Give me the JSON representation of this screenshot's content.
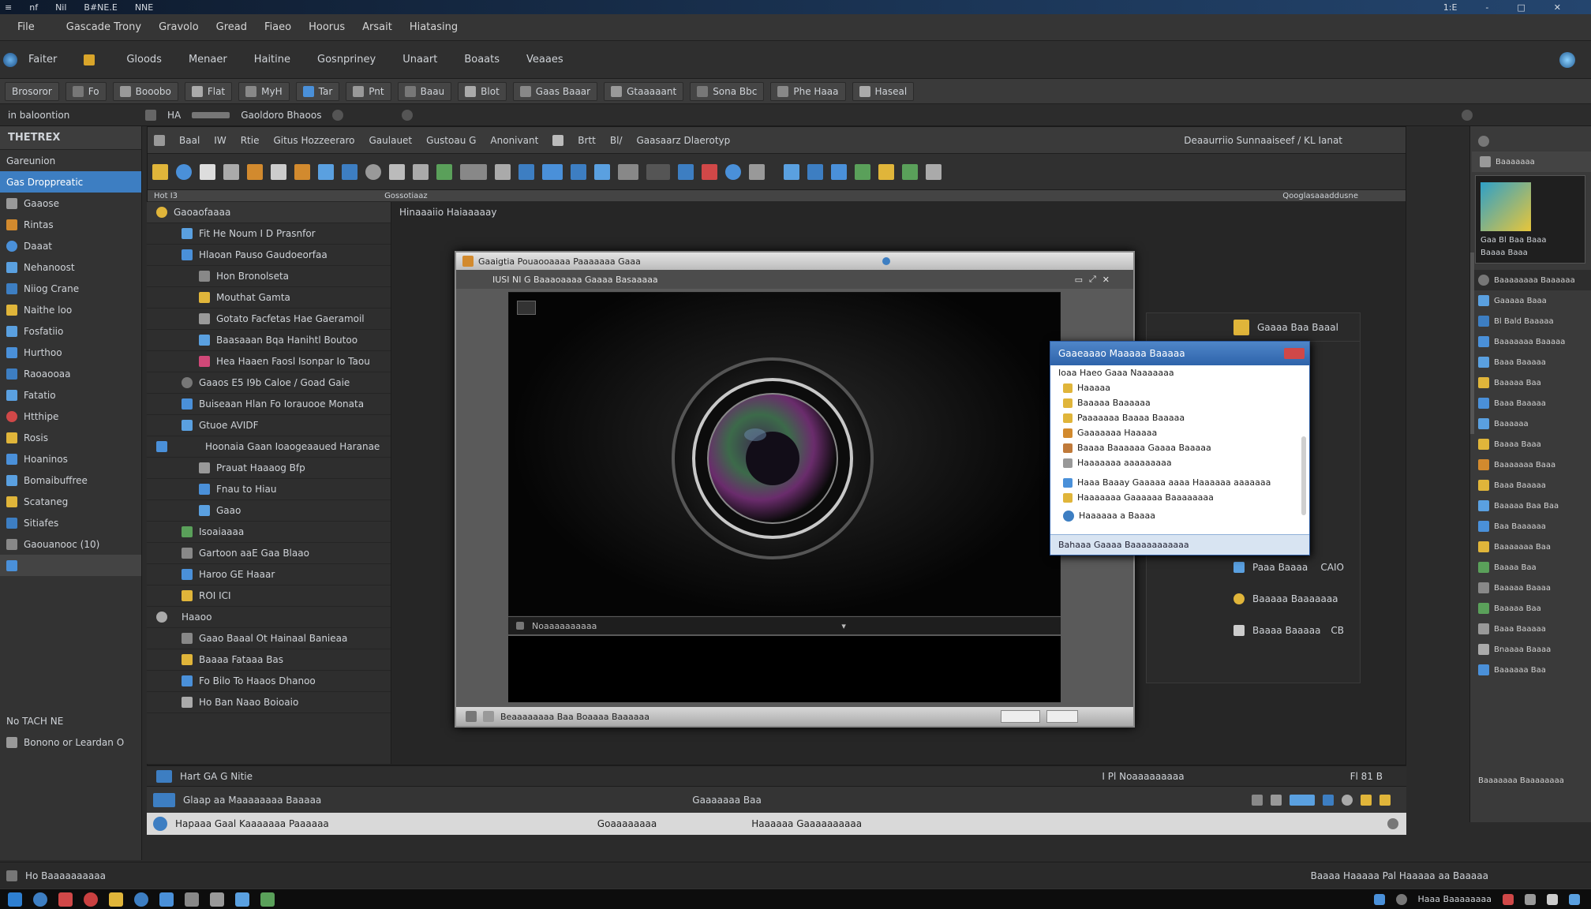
{
  "titlebar": {
    "items": [
      "≡",
      "nf",
      "Nil",
      "B#NE.E",
      "NNE"
    ],
    "right": [
      "1:E",
      "-",
      "□",
      "✕"
    ]
  },
  "menubar": {
    "items": [
      "File",
      "Gascade Trony",
      "Gravolo",
      "Gread",
      "Fiaeo",
      "Hoorus",
      "Arsait",
      "Hiatasing"
    ]
  },
  "menubar2": {
    "left": "Faiter",
    "items": [
      "Gloods",
      "Menaer",
      "Haitine",
      "Gosnpriney",
      "Unaart",
      "Boaats",
      "Veaaes"
    ]
  },
  "toolbar": {
    "items": [
      "Brosoror",
      "Fo",
      "Booobo",
      "Flat",
      "MyH",
      "Tar",
      "Pnt",
      "Baau",
      "Blot",
      "Gaas Baaar",
      "Gtaaaaant",
      "Sona Bbc",
      "Phe Haaa",
      "Haseal"
    ]
  },
  "subbar": {
    "left": "in baloontion",
    "mid": [
      "HA",
      "Gaoldoro Bhaoos"
    ]
  },
  "leftpanel": {
    "header": "THETREX",
    "items": [
      "Gareunion",
      "Gas Droppreatic",
      "Gaaose",
      "Rintas",
      "Daaat",
      "Nehanoost",
      "Niiog Crane",
      "Naithe loo",
      "Fosfatiio",
      "Hurthoo",
      "Raoaooaa",
      "Fatatio",
      "Htthipe",
      "Rosis",
      "Hoaninos",
      "Bomaibuffree",
      "Scataneg",
      "Sitiafes",
      "Gaouanooc (10)"
    ],
    "bottom": [
      "No TACH NE",
      "Bonono or Leardan O"
    ]
  },
  "ribbon": {
    "items": [
      "Baal",
      "IW",
      "Rtie",
      "Gitus Hozzeeraro",
      "Gaulauet",
      "Gustoau G",
      "Anonivant",
      "Brtt",
      "Bl/",
      "Gaasaarz Dlaerotyp"
    ],
    "right": "Deaaurriio Sunnaaiseef / KL Ianat"
  },
  "tabrow": {
    "left": "Hot I3",
    "mid": "Gossotiaaz",
    "right": "Qooglasaaaddusne"
  },
  "tree": {
    "header": "Gaoaofaaaa",
    "nodes": [
      {
        "lv": 1,
        "label": "Fit He Noum I D Prasnfor"
      },
      {
        "lv": 1,
        "label": "Hlaoan Pauso Gaudoeorfaa"
      },
      {
        "lv": 2,
        "label": "Hon Bronolseta"
      },
      {
        "lv": 2,
        "label": "Mouthat Gamta"
      },
      {
        "lv": 2,
        "label": "Gotato Facfetas Hae Gaeramoil"
      },
      {
        "lv": 2,
        "label": "Baasaaan Bqa Hanihtl Boutoo"
      },
      {
        "lv": 2,
        "label": "Hea Haaen Faosl Isonpar Io Taou"
      },
      {
        "lv": 1,
        "label": "Gaaos E5 I9b Caloe / Goad Gaie"
      },
      {
        "lv": 1,
        "label": "Buiseaan Hlan Fo Iorauooe Monata"
      },
      {
        "lv": 1,
        "label": "Gtuoe AVIDF"
      },
      {
        "lv": 1,
        "label": "Hoonaia Gaan Ioaogeaaued Haranae"
      },
      {
        "lv": 2,
        "label": "Prauat Haaaog Bfp"
      },
      {
        "lv": 2,
        "label": "Fnau to Hiau"
      },
      {
        "lv": 2,
        "label": "Gaao"
      },
      {
        "lv": 1,
        "label": "Isoaiaaaa"
      },
      {
        "lv": 1,
        "label": "Gartoon aaE Gaa Blaao"
      },
      {
        "lv": 1,
        "label": "Haroo GE Haaar"
      },
      {
        "lv": 1,
        "label": "ROI ICI"
      },
      {
        "lv": 1,
        "label": "Haaoo"
      },
      {
        "lv": 1,
        "label": "Gaao Baaal Ot Hainaal Banieaa"
      },
      {
        "lv": 1,
        "label": "Baaaa Fataaa Bas"
      },
      {
        "lv": 1,
        "label": "Fo Bilo To Haaos Dhanoo"
      },
      {
        "lv": 1,
        "label": "Ho Ban Naao Boioaio"
      }
    ]
  },
  "stage": {
    "header": "Hinaaaiio Haiaaaaay"
  },
  "viewer": {
    "title": "Gaaigtia Pouaooaaaa Paaaaaaa Gaaa",
    "bar": "IUSI NI G Baaaoaaaa Gaaaa Basaaaaa",
    "screen_label": "Noaaaaaaaaaa",
    "footer": "Beaaaaaaaa Baa Boaaaa Baaaaaa"
  },
  "dialog": {
    "title": "Gaaeaaao Maaaaa Baaaaa",
    "subtitle": "Ioaa Haeo Gaaa Naaaaaaa",
    "items": [
      "Haaaaa",
      "Baaaaa Baaaaaa",
      "Paaaaaaa Baaaa Baaaaa",
      "Gaaaaaaa Haaaaa",
      "Baaaa Baaaaaa Gaaaa Baaaaa",
      "Haaaaaaa aaaaaaaaa",
      "Haaa Baaay Gaaaaa aaaa Haaaaaa aaaaaaa",
      "Haaaaaaa Gaaaaaa Baaaaaaaa",
      "Haaaaaa a Baaaa"
    ],
    "footer": "Bahaaa Gaaaa Baaaaaaaaaaa"
  },
  "sidepanel": {
    "header": "Gaaaa Baa Baaal",
    "rows": [
      {
        "label": "Paaa Baaaa",
        "val": "CAIO"
      },
      {
        "label": "Baaaaa Baaaaaaa",
        "val": ""
      },
      {
        "label": "Baaaa Baaaaa",
        "val": "CB"
      }
    ]
  },
  "farright": {
    "header": "Baaaaaaa",
    "caption": [
      "Gaa Bl Baa Baaa",
      "Baaaa Baaa"
    ],
    "section": "Baaaaaaaa Baaaaaa",
    "items": [
      "Gaaaaa Baaa",
      "Bl Bald Baaaaa",
      "Baaaaaaa Baaaaa",
      "Baaa Baaaaa",
      "Baaaaa Baa",
      "Baaa Baaaaa",
      "Baaaaaa",
      "Baaaa Baaa",
      "Baaaaaaa Baaa",
      "Baaa Baaaaa",
      "Baaaaa Baa Baa",
      "Baa Baaaaaa",
      "Baaaaaaa Baa",
      "Baaaa Baa",
      "Baaaaa Baaaa",
      "Baaaaa Baa",
      "Baaa Baaaaa",
      "Bnaaaa Baaaa",
      "Baaaaaa Baa"
    ],
    "footer": "Baaaaaaa Baaaaaaaa"
  },
  "bottom1": {
    "left": "Hart GA G Nitie",
    "mid": "I Pl Noaaaaaaaaa",
    "right": "Fl 81 B"
  },
  "bottom2": {
    "left": "Glaap aa Maaaaaaaa Baaaaa",
    "mid": "Gaaaaaaa Baa"
  },
  "bottom3": {
    "left": "Hapaaa Gaal Kaaaaaaa Paaaaaa",
    "mid": "Goaaaaaaaa",
    "right": "Haaaaaa Gaaaaaaaaaa"
  },
  "statusbar": {
    "left": "Ho Baaaaaaaaaa",
    "right": "Baaaa Haaaaa Pal Haaaaa aa Baaaaa"
  },
  "taskbar": {
    "right": "Haaa Baaaaaaaa"
  },
  "colors": {
    "accent": "#3d7ec2",
    "dialog_title": "#2e63aa"
  }
}
